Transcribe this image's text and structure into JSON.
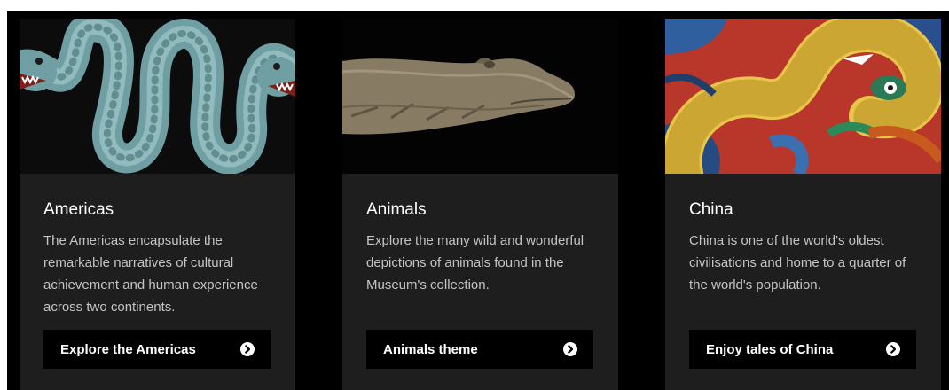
{
  "colors": {
    "background": "#000000",
    "card": "#1e1e1e",
    "title": "#ffffff",
    "description": "#c4c4c4",
    "button": "#000000",
    "button_text": "#ffffff"
  },
  "cards": [
    {
      "title": "Americas",
      "description": "The Americas encapsulate the remarkable narratives of cultural achievement and human experience across two continents.",
      "button_label": "Explore the Americas",
      "image_icon": "turquoise-double-headed-serpent-image",
      "button_icon": "arrow-right-circle-icon"
    },
    {
      "title": "Animals",
      "description": "Explore the many wild and wonderful depictions of animals found in the Museum's collection.",
      "button_label": "Animals theme",
      "image_icon": "carved-crocodile-image",
      "button_icon": "arrow-right-circle-icon"
    },
    {
      "title": "China",
      "description": "China is one of the world's oldest civilisations and home to a quarter of the world's population.",
      "button_label": "Enjoy tales of China",
      "image_icon": "glazed-tile-dragon-image",
      "button_icon": "arrow-right-circle-icon"
    }
  ]
}
